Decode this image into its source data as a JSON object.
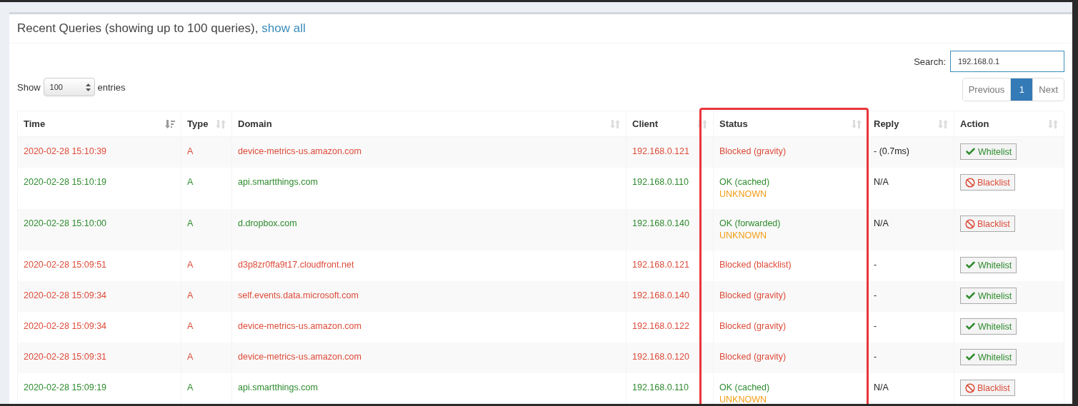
{
  "box": {
    "title": "Recent Queries (showing up to 100 queries),",
    "title_link": "show all"
  },
  "length_control": {
    "before": "Show",
    "value": "100",
    "after": "entries"
  },
  "search": {
    "label": "Search:",
    "value": "192.168.0.1"
  },
  "pagination": [
    {
      "label": "Previous",
      "selected": false
    },
    {
      "label": "1",
      "selected": true
    },
    {
      "label": "Next",
      "selected": false
    }
  ],
  "table": {
    "columns": [
      {
        "label": "Time",
        "sorted": true,
        "highlighted": false
      },
      {
        "label": "Type",
        "sorted": false,
        "highlighted": false
      },
      {
        "label": "Domain",
        "sorted": false,
        "highlighted": false
      },
      {
        "label": "Client",
        "sorted": false,
        "highlighted": false
      },
      {
        "label": "Status",
        "sorted": false,
        "highlighted": true
      },
      {
        "label": "Reply",
        "sorted": false,
        "highlighted": false
      },
      {
        "label": "Action",
        "sorted": false,
        "highlighted": false
      }
    ],
    "rows": [
      {
        "kind": "blocked",
        "time": "2020-02-28 15:10:39",
        "type": "A",
        "domain": "device-metrics-us.amazon.com",
        "client": "192.168.0.121",
        "status": "Blocked (gravity)",
        "reply": "- (0.7ms)",
        "action": {
          "kind": "whitelist",
          "label": "Whitelist"
        }
      },
      {
        "kind": "allowed",
        "time": "2020-02-28 15:10:19",
        "type": "A",
        "domain": "api.smartthings.com",
        "client": "192.168.0.110",
        "status": "OK (cached)",
        "dnssec": "UNKNOWN",
        "reply": "N/A",
        "action": {
          "kind": "blacklist",
          "label": "Blacklist"
        }
      },
      {
        "kind": "allowed",
        "time": "2020-02-28 15:10:00",
        "type": "A",
        "domain": "d.dropbox.com",
        "client": "192.168.0.140",
        "status": "OK (forwarded)",
        "dnssec": "UNKNOWN",
        "reply": "N/A",
        "action": {
          "kind": "blacklist",
          "label": "Blacklist"
        }
      },
      {
        "kind": "blocked",
        "time": "2020-02-28 15:09:51",
        "type": "A",
        "domain": "d3p8zr0ffa9t17.cloudfront.net",
        "client": "192.168.0.121",
        "status": "Blocked (blacklist)",
        "reply": "-",
        "action": {
          "kind": "whitelist",
          "label": "Whitelist"
        }
      },
      {
        "kind": "blocked",
        "time": "2020-02-28 15:09:34",
        "type": "A",
        "domain": "self.events.data.microsoft.com",
        "client": "192.168.0.140",
        "status": "Blocked (gravity)",
        "reply": "-",
        "action": {
          "kind": "whitelist",
          "label": "Whitelist"
        }
      },
      {
        "kind": "blocked",
        "time": "2020-02-28 15:09:34",
        "type": "A",
        "domain": "device-metrics-us.amazon.com",
        "client": "192.168.0.122",
        "status": "Blocked (gravity)",
        "reply": "-",
        "action": {
          "kind": "whitelist",
          "label": "Whitelist"
        }
      },
      {
        "kind": "blocked",
        "time": "2020-02-28 15:09:31",
        "type": "A",
        "domain": "device-metrics-us.amazon.com",
        "client": "192.168.0.120",
        "status": "Blocked (gravity)",
        "reply": "-",
        "action": {
          "kind": "whitelist",
          "label": "Whitelist"
        }
      },
      {
        "kind": "allowed",
        "time": "2020-02-28 15:09:19",
        "type": "A",
        "domain": "api.smartthings.com",
        "client": "192.168.0.110",
        "status": "OK (cached)",
        "dnssec": "UNKNOWN",
        "reply": "N/A",
        "action": {
          "kind": "blacklist",
          "label": "Blacklist"
        }
      }
    ]
  }
}
